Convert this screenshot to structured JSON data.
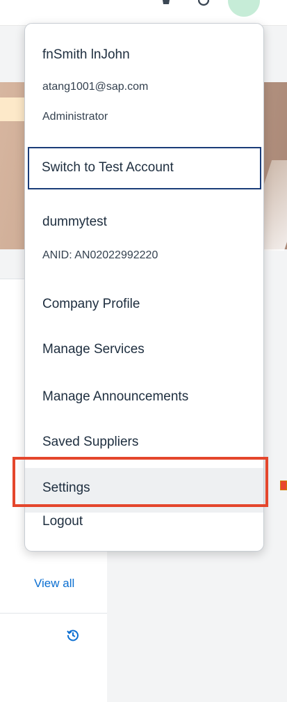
{
  "user": {
    "name": "fnSmith lnJohn",
    "email": "atang1001@sap.com",
    "role": "Administrator"
  },
  "switch_account_label": "Switch to Test Account",
  "account": {
    "name": "dummytest",
    "anid": "ANID: AN02022992220"
  },
  "menu_items": [
    {
      "label": "Company Profile"
    },
    {
      "label": "Manage Services"
    },
    {
      "label": "Manage Announcements"
    },
    {
      "label": "Saved Suppliers"
    },
    {
      "label": "Settings"
    },
    {
      "label": "Logout"
    }
  ],
  "background": {
    "view_all_label": "View all"
  },
  "colors": {
    "highlight": "#e4462c",
    "link": "#0a6ed1",
    "focus_border": "#1a3c78"
  }
}
